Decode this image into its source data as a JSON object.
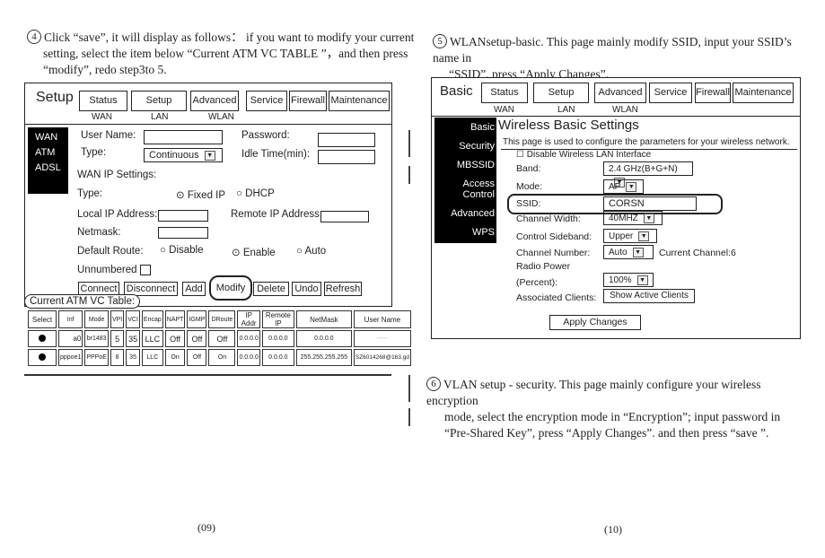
{
  "left_page": {
    "step_number": "4",
    "instruction_lines": [
      "Click “save”, it will display as follows： if you want to modify your current",
      "setting, select the item below “Current ATM VC TABLE ”，and then press",
      "“modify”, redo step3to 5."
    ],
    "page_number": "(09)",
    "ui": {
      "title": "Setup",
      "nav": [
        "Status",
        "Setup",
        "Advanced",
        "Service",
        "Firewall",
        "Maintenance"
      ],
      "subnav": [
        "WAN",
        "LAN",
        "WLAN"
      ],
      "sidebar": [
        "WAN",
        "ATM",
        "ADSL"
      ],
      "user_name_label": "User Name:",
      "password_label": "Password:",
      "type_label": "Type:",
      "type_value": "Continuous",
      "idle_time_label": "Idle Time(min):",
      "wan_ip_settings": "WAN IP Settings:",
      "ip_type_label": "Type:",
      "fixed_ip": "Fixed IP",
      "dhcp": "DHCP",
      "local_ip_label": "Local IP Address:",
      "remote_ip_label": "Remote IP Address:",
      "netmask_label": "Netmask:",
      "default_route_label": "Default Route:",
      "disable": "Disable",
      "enable": "Enable",
      "auto": "Auto",
      "unnumbered_label": "Unnumbered",
      "actions": [
        "Connect",
        "Disconnect",
        "Add",
        "Modify",
        "Delete",
        "Undo",
        "Refresh"
      ],
      "table_title": "Current ATM VC Table:",
      "table_headers": [
        "Select",
        "Inf",
        "Mode",
        "VPI",
        "VCI",
        "Encap",
        "NAPT",
        "IGMP",
        "DRoute",
        "IP Addr",
        "Remote IP",
        "NetMask",
        "User Name"
      ],
      "table_rows": [
        [
          "",
          "a0",
          "br1483",
          "5",
          "35",
          "LLC",
          "Off",
          "Off",
          "Off",
          "0.0.0.0",
          "0.0.0.0",
          "0.0.0.0",
          "-----"
        ],
        [
          "",
          "pppoe1",
          "PPPoE",
          "8",
          "35",
          "LLC",
          "On",
          "Off",
          "On",
          "0.0.0.0",
          "0.0.0.0",
          "255.255.255.255",
          "SZ6014268@163.gd"
        ]
      ]
    }
  },
  "right_page": {
    "step5_number": "5",
    "step5_lines": [
      "WLANsetup-basic. This page mainly modify  SSID,  input your SSID’s name in",
      "“SSID”,  press “Apply Changes”."
    ],
    "step6_number": "6",
    "step6_lines": [
      "VLAN setup - security. This page mainly configure your wireless encryption",
      "mode, select  the encryption mode in “Encryption”; input password in",
      "“Pre-Shared Key”, press “Apply Changes”. and then press “save ”."
    ],
    "page_number": "(10)",
    "ui": {
      "title": "Basic",
      "nav": [
        "Status",
        "Setup",
        "Advanced",
        "Service",
        "Firewall",
        "Maintenance"
      ],
      "subnav": [
        "WAN",
        "LAN",
        "WLAN"
      ],
      "sidebar": [
        "Basic",
        "Security",
        "MBSSID",
        "Access Control",
        "Advanced",
        "WPS"
      ],
      "heading": "Wireless Basic Settings",
      "description": "This page is used to configure the parameters for your wireless network.",
      "disable_wlan": "Disable Wireless LAN Interface",
      "fields": [
        {
          "label": "Band:",
          "value": "2.4 GHz(B+G+N)"
        },
        {
          "label": "Mode:",
          "value": "AP"
        },
        {
          "label": "SSID:",
          "value": "CORSN"
        },
        {
          "label": "Channel Width:",
          "value": "40MHZ"
        },
        {
          "label": "Control Sideband:",
          "value": "Upper"
        },
        {
          "label": "Channel Number:",
          "value": "Auto"
        },
        {
          "label": "Radio Power (Percent):",
          "value": "100%"
        },
        {
          "label": "Associated Clients:",
          "value": "Show Active Clients"
        }
      ],
      "radio_power_line1": "Radio Power",
      "radio_power_line2": "(Percent):",
      "current_channel": "Current Channel:6",
      "apply_button": "Apply Changes"
    }
  }
}
